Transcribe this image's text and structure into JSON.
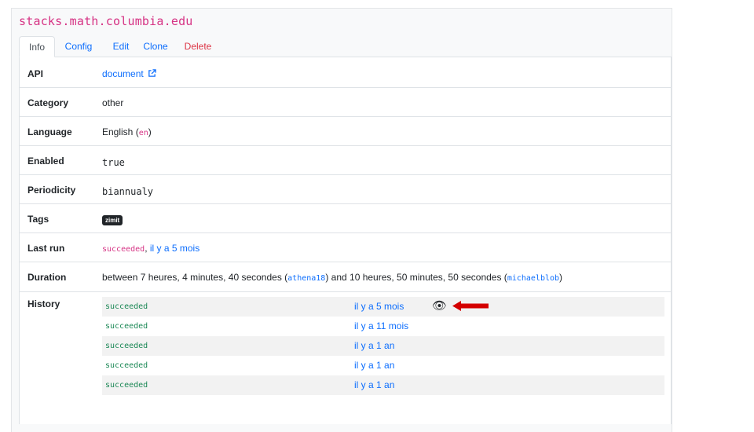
{
  "header": {
    "site_title": "stacks.math.columbia.edu"
  },
  "tabs": [
    {
      "label": "Info",
      "active": true
    },
    {
      "label": "Config"
    },
    {
      "label": "Edit"
    },
    {
      "label": "Clone"
    },
    {
      "label": "Delete"
    }
  ],
  "details": {
    "api": {
      "label": "API",
      "value": "document"
    },
    "category": {
      "label": "Category",
      "value": "other"
    },
    "language": {
      "label": "Language",
      "value": "English (",
      "code": "en",
      "close": ")"
    },
    "enabled": {
      "label": "Enabled",
      "value": "true"
    },
    "periodicity": {
      "label": "Periodicity",
      "value": "biannualy"
    },
    "tags": {
      "label": "Tags",
      "value": "zimit"
    },
    "last_run": {
      "label": "Last run",
      "status": "succeeded",
      "sep": ", ",
      "time": "il y a 5 mois"
    },
    "duration": {
      "label": "Duration",
      "part1": "between 7 heures, 4 minutes, 40 secondes (",
      "worker1": "athena18",
      "part2": ") and 10 heures, 50 minutes, 50 secondes (",
      "worker2": "michaelblob",
      "part3": ")"
    },
    "history_label": "History"
  },
  "history": [
    {
      "status": "succeeded",
      "time": "il y a 5 mois"
    },
    {
      "status": "succeeded",
      "time": "il y a 11 mois"
    },
    {
      "status": "succeeded",
      "time": "il y a 1 an"
    },
    {
      "status": "succeeded",
      "time": "il y a 1 an"
    },
    {
      "status": "succeeded",
      "time": "il y a 1 an"
    }
  ],
  "icons": {
    "external_link": "external-link-icon",
    "eye": "eye-icon",
    "arrow": "red-arrow-left-icon"
  },
  "colors": {
    "link": "#0d6efd",
    "danger": "#dc3545",
    "code": "#d63384",
    "success": "#198754",
    "arrow": "#d40000"
  }
}
